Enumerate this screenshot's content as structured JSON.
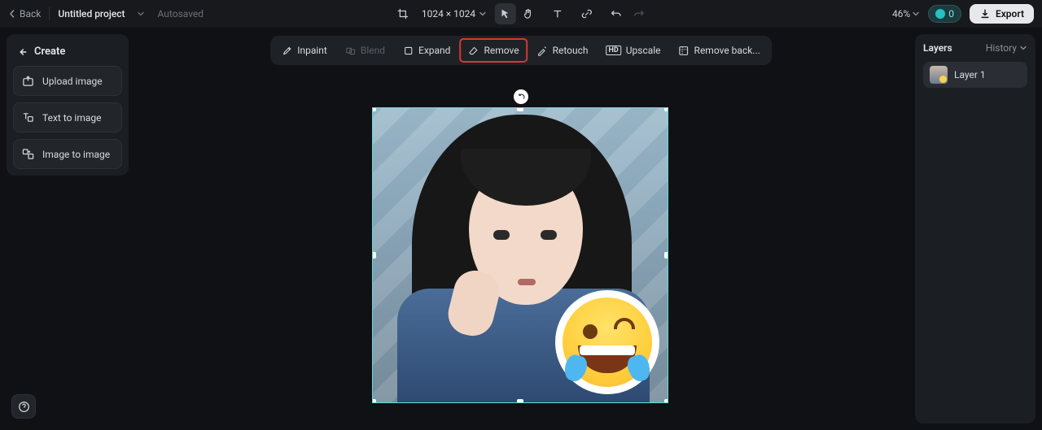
{
  "topbar": {
    "back": "Back",
    "project_name": "Untitled project",
    "autosaved": "Autosaved",
    "dimensions": "1024 × 1024",
    "zoom": "46%",
    "credits": "0",
    "export": "Export"
  },
  "create": {
    "title": "Create",
    "items": [
      {
        "id": "upload-image",
        "label": "Upload image"
      },
      {
        "id": "text-to-image",
        "label": "Text to image"
      },
      {
        "id": "image-to-image",
        "label": "Image to image"
      }
    ]
  },
  "tools": {
    "inpaint": "Inpaint",
    "blend": "Blend",
    "expand": "Expand",
    "remove": "Remove",
    "retouch": "Retouch",
    "upscale": "Upscale",
    "remove_bg": "Remove back..."
  },
  "layers": {
    "title": "Layers",
    "history": "History",
    "items": [
      {
        "label": "Layer 1"
      }
    ]
  }
}
